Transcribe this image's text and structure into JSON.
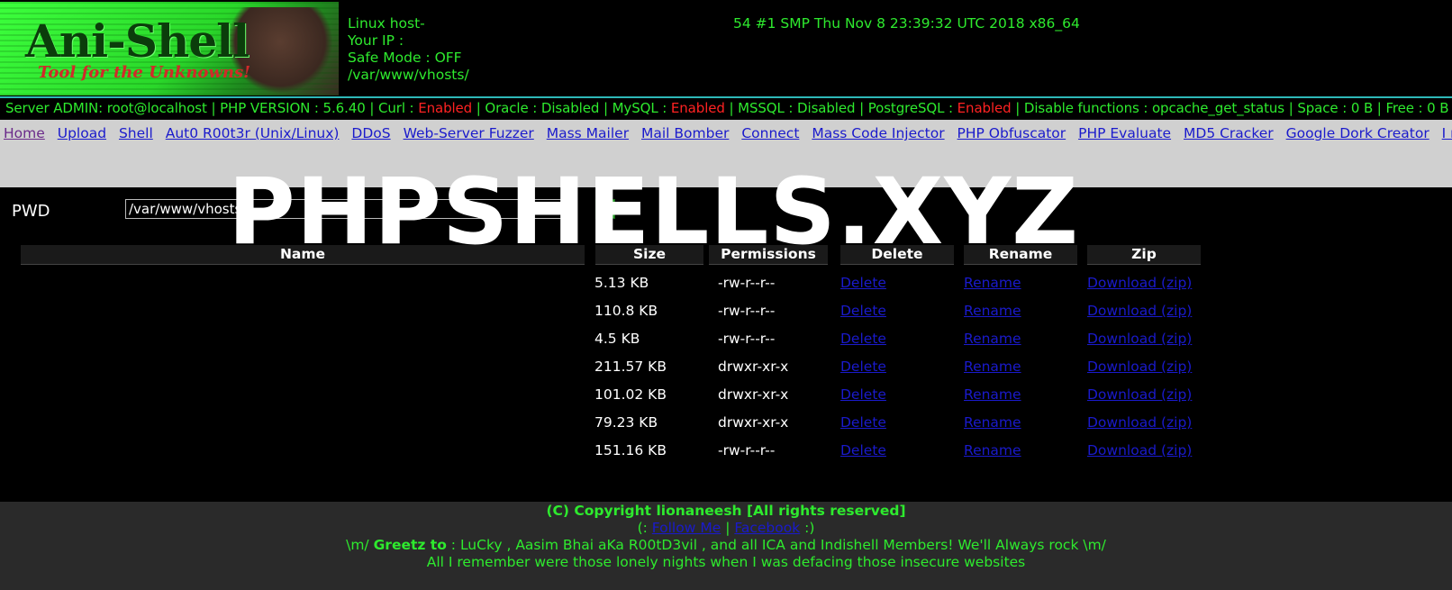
{
  "header": {
    "logo_title": "Ani-Shell",
    "logo_subtitle": "Tool for the Unknowns!",
    "uname_prefix": "Linux host-",
    "uname_suffix": "54 #1 SMP Thu Nov 8 23:39:32 UTC 2018 x86_64",
    "your_ip": "Your IP :",
    "safe_mode": "Safe Mode : OFF",
    "cwd": "/var/www/vhosts/"
  },
  "status": {
    "server_admin": "Server ADMIN: root@localhost",
    "php_version": "PHP VERSION : 5.6.40",
    "curl_label": "Curl :",
    "curl_value": "Enabled",
    "oracle": "Oracle : Disabled",
    "mysql_label": "MySQL :",
    "mysql_value": "Enabled",
    "mssql": "MSSQL : Disabled",
    "postgres_label": "PostgreSQL :",
    "postgres_value": "Enabled",
    "disabled_functions": "Disable functions : opcache_get_status",
    "space": "Space : 0 B",
    "free": "Free : 0 B",
    "separator": " | "
  },
  "nav": {
    "items": [
      {
        "label": "Home"
      },
      {
        "label": "Upload"
      },
      {
        "label": "Shell"
      },
      {
        "label": "Aut0 R00t3r (Unix/Linux)"
      },
      {
        "label": "DDoS"
      },
      {
        "label": "Web-Server Fuzzer"
      },
      {
        "label": "Mass Mailer"
      },
      {
        "label": "Mail Bomber"
      },
      {
        "label": "Connect"
      },
      {
        "label": "Mass Code Injector"
      },
      {
        "label": "PHP Obfuscator"
      },
      {
        "label": "PHP Evaluate"
      },
      {
        "label": "MD5 Cracker"
      },
      {
        "label": "Google Dork Creator"
      },
      {
        "label": "I m Out!"
      }
    ]
  },
  "pwd": {
    "label": "PWD",
    "value": "/var/www/vhosts"
  },
  "watermark": "PHPSHELLS.XYZ",
  "table": {
    "headers": {
      "name": "Name",
      "size": "Size",
      "permissions": "Permissions",
      "delete": "Delete",
      "rename": "Rename",
      "zip": "Zip"
    },
    "rows": [
      {
        "size": "5.13 KB",
        "perms": "-rw-r--r--",
        "delete": "Delete",
        "rename": "Rename",
        "zip": "Download (zip)"
      },
      {
        "size": "110.8 KB",
        "perms": "-rw-r--r--",
        "delete": "Delete",
        "rename": "Rename",
        "zip": "Download (zip)"
      },
      {
        "size": "4.5 KB",
        "perms": "-rw-r--r--",
        "delete": "Delete",
        "rename": "Rename",
        "zip": "Download (zip)"
      },
      {
        "size": "211.57 KB",
        "perms": "drwxr-xr-x",
        "delete": "Delete",
        "rename": "Rename",
        "zip": "Download (zip)"
      },
      {
        "size": "101.02 KB",
        "perms": "drwxr-xr-x",
        "delete": "Delete",
        "rename": "Rename",
        "zip": "Download (zip)"
      },
      {
        "size": "79.23 KB",
        "perms": "drwxr-xr-x",
        "delete": "Delete",
        "rename": "Rename",
        "zip": "Download (zip)"
      },
      {
        "size": "151.16 KB",
        "perms": "-rw-r--r--",
        "delete": "Delete",
        "rename": "Rename",
        "zip": "Download (zip)"
      }
    ]
  },
  "footer": {
    "copyright": "(C) Copyright lionaneesh [All rights reserved]",
    "open": "(:",
    "follow": "Follow Me",
    "pipe": "|",
    "facebook": "Facebook",
    "close": ":)",
    "greetz_prefix": "\\m/",
    "greetz_label": "Greetz to",
    "greetz_text": ": LuCky , Aasim Bhai aKa R00tD3vil , and all ICA and Indishell Members! We'll Always rock \\m/",
    "tagline": "All I remember were those lonely nights when I was defacing those insecure websites"
  },
  "colors": {
    "accent_green": "#2eea2e",
    "enabled_red": "#ff2222",
    "link_blue": "#1a1acc",
    "nav_bg": "#d0d0d0"
  }
}
